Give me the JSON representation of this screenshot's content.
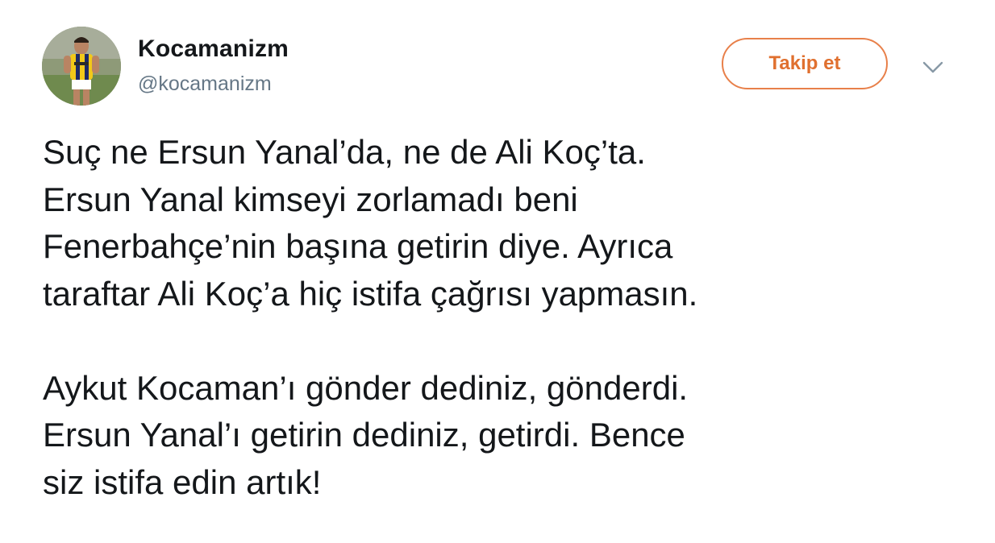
{
  "tweet": {
    "author": {
      "display_name": "Kocamanizm",
      "handle": "@kocamanizm",
      "avatar_icon": "profile-photo-footballer"
    },
    "follow_button_label": "Takip et",
    "menu_icon": "chevron-down-icon",
    "paragraphs": [
      [
        "Suç ne Ersun Yanal’da, ne de Ali Koç’ta.",
        "Ersun Yanal kimseyi zorlamadı beni",
        "Fenerbahçe’nin başına getirin diye. Ayrıca",
        "taraftar Ali Koç’a hiç istifa çağrısı yapmasın."
      ],
      [
        "Aykut Kocaman’ı gönder dediniz, gönderdi.",
        "Ersun Yanal’ı getirin dediniz, getirdi. Bence",
        "siz istifa edin artık!"
      ]
    ]
  },
  "colors": {
    "accent": "#e0702f",
    "text": "#14171a",
    "secondary_text": "#657786"
  }
}
